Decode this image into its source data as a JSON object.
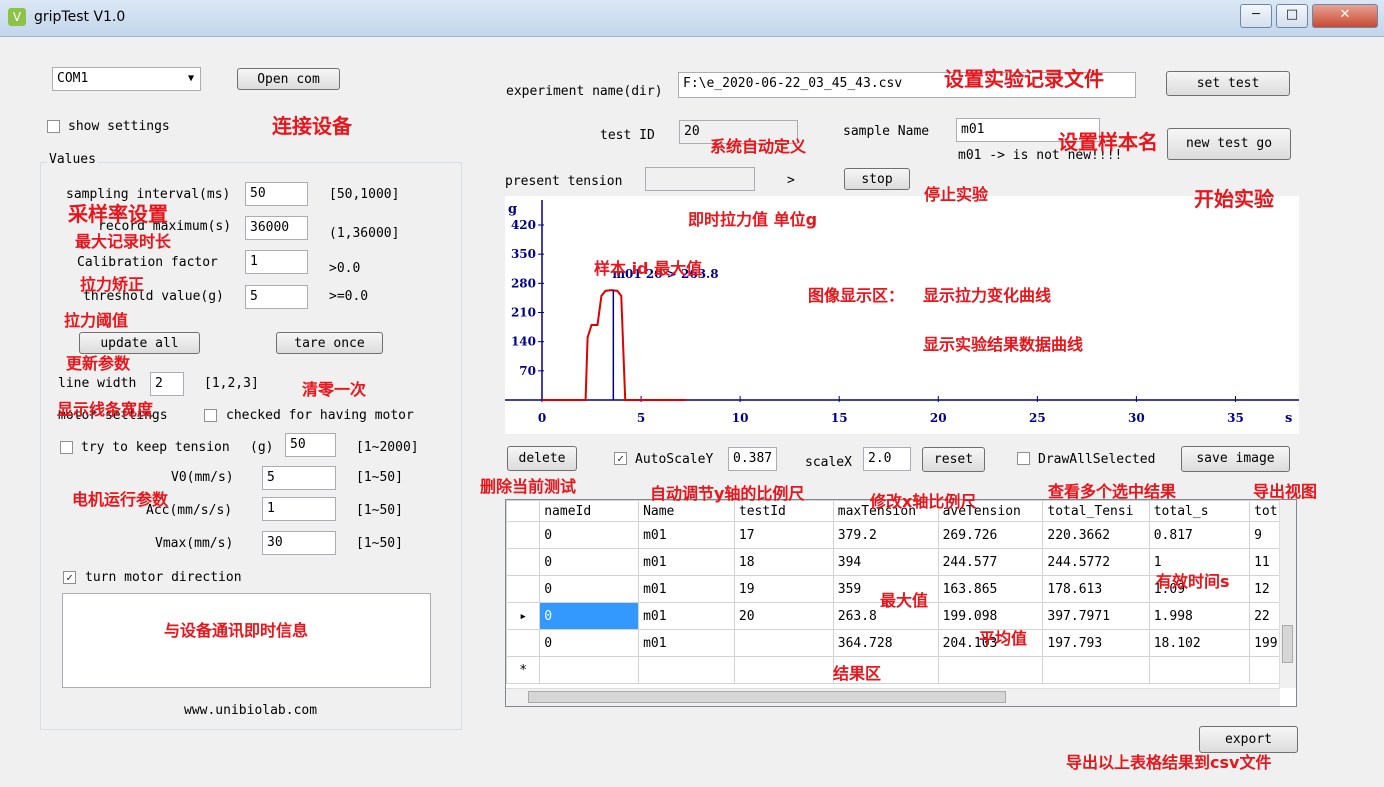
{
  "window": {
    "title": "gripTest V1.0",
    "icon_glyph": "V",
    "minimize": "─",
    "maximize": "□",
    "close": "✕"
  },
  "connection": {
    "port_value": "COM1",
    "open_button": "Open com",
    "show_settings": "show settings"
  },
  "values_group": {
    "title": "Values",
    "sampling_label": "sampling interval(ms)",
    "sampling_value": "50",
    "sampling_range": "[50,1000]",
    "record_label": "record maximum(s)",
    "record_value": "36000",
    "record_range": "(1,36000]",
    "calib_label": "Calibration factor",
    "calib_value": "1",
    "calib_range": ">0.0",
    "threshold_label": "threshold value(g)",
    "threshold_value": "5",
    "threshold_range": ">=0.0",
    "update_all": "update all",
    "tare_once": "tare once",
    "line_width_label": "line width",
    "line_width_value": "2",
    "line_width_range": "[1,2,3]",
    "motor_settings": "motor settings",
    "checked_motor": "checked for having motor",
    "keep_tension_label": "try to keep tension",
    "keep_tension_unit": "(g)",
    "keep_tension_value": "50",
    "keep_tension_range": "[1~2000]",
    "v0_label": "V0(mm/s)",
    "v0_value": "5",
    "v0_range": "[1~50]",
    "acc_label": "Acc(mm/s/s)",
    "acc_value": "1",
    "acc_range": "[1~50]",
    "vmax_label": "Vmax(mm/s)",
    "vmax_value": "30",
    "vmax_range": "[1~50]",
    "turn_motor": "turn motor direction",
    "turn_motor_checked": "✓",
    "website": "www.unibiolab.com"
  },
  "experiment": {
    "name_label": "experiment name(dir)",
    "name_value": "F:\\e_2020-06-22_03_45_43.csv",
    "set_test": "set test",
    "test_id_label": "test ID",
    "test_id_value": "20",
    "sample_name_label": "sample Name",
    "sample_name_value": "m01",
    "new_test_go": "new test go",
    "not_new_msg": "m01 -> is not new!!!!",
    "present_tension_label": "present tension",
    "present_tension_arrow": ">",
    "stop": "stop"
  },
  "controls": {
    "delete": "delete",
    "autoscale_label": "AutoScaleY",
    "autoscale_checked": "✓",
    "autoscale_value": "0.387",
    "scalex_label": "scaleX",
    "scalex_value": "2.0",
    "reset": "reset",
    "draw_all": "DrawAllSelected",
    "save_image": "save image",
    "export": "export"
  },
  "grid": {
    "columns": [
      "nameId",
      "Name",
      "testId",
      "maxTension",
      "aveTension",
      "total_Tensi",
      "total_s",
      "tot"
    ],
    "rows": [
      [
        "0",
        "m01",
        "17",
        "379.2",
        "269.726",
        "220.3662",
        "0.817",
        "9"
      ],
      [
        "0",
        "m01",
        "18",
        "394",
        "244.577",
        "244.5772",
        "1",
        "11"
      ],
      [
        "0",
        "m01",
        "19",
        "359",
        "163.865",
        "178.613",
        "1.09",
        "12"
      ],
      [
        "0",
        "m01",
        "20",
        "263.8",
        "199.098",
        "397.7971",
        "1.998",
        "22"
      ],
      [
        "0",
        "m01",
        "",
        "364.728",
        "204.103",
        "197.793",
        "18.102",
        "199"
      ]
    ],
    "current_row_marker": "▸",
    "new_row_marker": "*"
  },
  "chart_data": {
    "type": "line",
    "ylabel": "g",
    "xlabel": "s",
    "xlim": [
      0,
      37.5
    ],
    "ylim": [
      0,
      480
    ],
    "x_ticks": [
      0,
      5,
      10,
      15,
      20,
      25,
      30,
      35
    ],
    "y_ticks": [
      70,
      140,
      210,
      280,
      350,
      420
    ],
    "annotation": "m01 20 > 263.8",
    "series": [
      {
        "color": "#e00000",
        "x": [
          0,
          2.2,
          2.3,
          2.5,
          2.8,
          3.0,
          3.2,
          3.5,
          3.8,
          4.0,
          4.2,
          4.4,
          7.3
        ],
        "y": [
          0,
          0,
          150,
          180,
          180,
          250,
          262,
          263.8,
          262,
          250,
          0,
          0,
          0
        ]
      }
    ],
    "marker_x": 3.6
  },
  "annotations": {
    "connect_device": "连接设备",
    "sampling_rate": "采样率设置",
    "max_record": "最大记录时长",
    "calibrate": "拉力矫正",
    "threshold": "拉力阈值",
    "update_params": "更新参数",
    "tare": "清零一次",
    "line_width": "显示线条宽度",
    "motor_params": "电机运行参数",
    "comm_info": "与设备通讯即时信息",
    "set_record_file": "设置实验记录文件",
    "auto_defined": "系统自动定义",
    "set_sample_name": "设置样本名",
    "stop_exp": "停止实验",
    "start_exp": "开始实验",
    "instant_tension": "即时拉力值 单位g",
    "sample_id_max": "样本  id  最大值",
    "display_area": "图像显示区：",
    "display_curve": "显示拉力变化曲线",
    "display_result": "显示实验结果数据曲线",
    "delete_current": "删除当前测试",
    "auto_y": "自动调节y轴的比例尺",
    "modify_x": "修改x轴比例尺",
    "view_multi": "查看多个选中结果",
    "export_view": "导出视图",
    "valid_time": "有效时间s",
    "max_value": "最大值",
    "avg_value": "平均值",
    "result_area": "结果区",
    "export_csv": "导出以上表格结果到csv文件"
  }
}
